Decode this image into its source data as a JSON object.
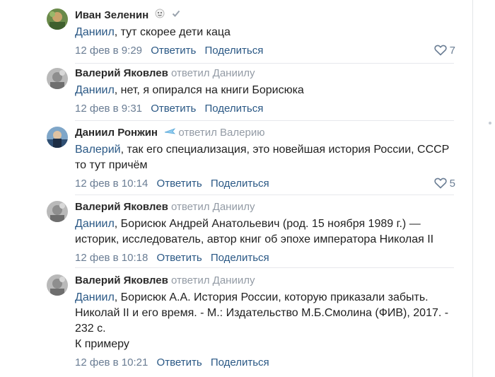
{
  "comments": [
    {
      "author": "Иван Зеленин",
      "reply_to": "",
      "mention": "Даниил",
      "text": ", тут скорее дети каца",
      "date": "12 фев в 9:29",
      "reply_label": "Ответить",
      "share_label": "Поделиться",
      "likes": "7",
      "avatar_icon": "avatar-green",
      "badge_icon": "verified-check-icon"
    },
    {
      "author": "Валерий Яковлев",
      "reply_to": "ответил Даниилу",
      "mention": "Даниил",
      "text": ", нет, я опирался на книги Борисюка",
      "date": "12 фев в 9:31",
      "reply_label": "Ответить",
      "share_label": "Поделиться"
    },
    {
      "author": "Даниил Ронжин",
      "reply_to": "ответил Валерию",
      "mention": "Валерий",
      "text": ", так его специализация, это новейшая история России, СССР то тут причём",
      "date": "12 фев в 10:14",
      "reply_label": "Ответить",
      "share_label": "Поделиться",
      "likes": "5"
    },
    {
      "author": "Валерий Яковлев",
      "reply_to": "ответил Даниилу",
      "mention": "Даниил",
      "text": ", Борисюк Андрей Анатольевич (род. 15 ноября 1989 г.) — историк, исследователь, автор книг об эпохе императора Николая II",
      "date": "12 фев в 10:18",
      "reply_label": "Ответить",
      "share_label": "Поделиться"
    },
    {
      "author": "Валерий Яковлев",
      "reply_to": "ответил Даниилу",
      "mention": "Даниил",
      "text": ", Борисюк А.А. История России, которую приказали забыть. Николай II и его время. - М.: Издательство М.Б.Смолина (ФИВ), 2017. - 232 с.",
      "text2": "К примеру",
      "date": "12 фев в 10:21",
      "reply_label": "Ответить",
      "share_label": "Поделиться"
    }
  ],
  "colors": {
    "link": "#2a5885",
    "meta": "#6a7d94",
    "reply_to": "#939ba5"
  }
}
